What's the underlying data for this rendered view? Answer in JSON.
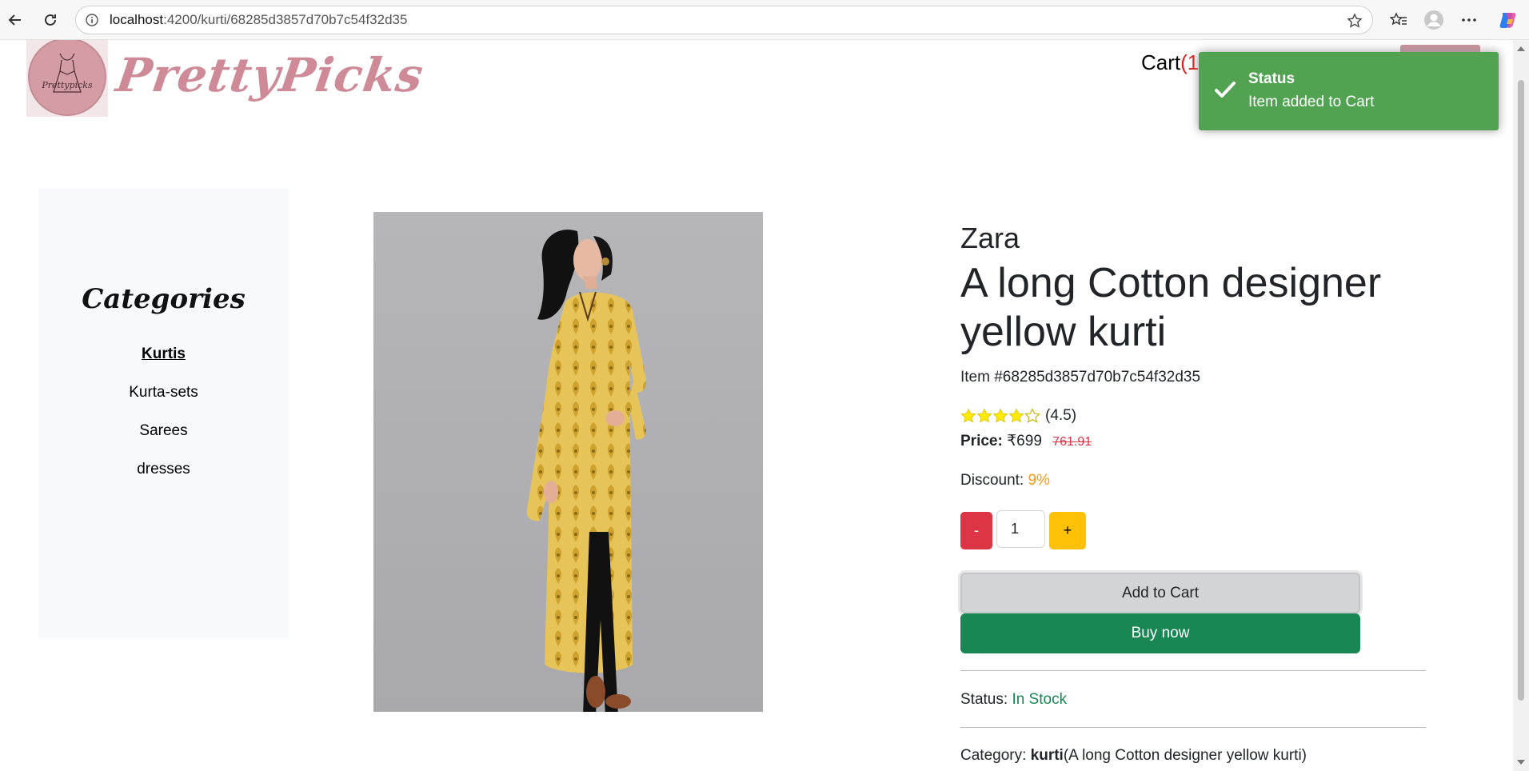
{
  "browser": {
    "url_host": "localhost",
    "url_path": ":4200/kurti/68285d3857d70b7c54f32d35"
  },
  "header": {
    "logo_text": "PrettyPicks",
    "logo_mini_text": "Prettypicks",
    "cart_label": "Cart",
    "cart_count": "(1)"
  },
  "toast": {
    "title": "Status",
    "message": "Item added to Cart",
    "color": "#51a351"
  },
  "sidebar": {
    "heading": "Categories",
    "items": [
      {
        "label": "Kurtis",
        "active": true
      },
      {
        "label": "Kurta-sets",
        "active": false
      },
      {
        "label": "Sarees",
        "active": false
      },
      {
        "label": "dresses",
        "active": false
      }
    ]
  },
  "product": {
    "brand": "Zara",
    "title": "A long Cotton designer yellow kurti",
    "item_id": "Item #68285d3857d70b7c54f32d35",
    "rating": 4.5,
    "rating_text": "(4.5)",
    "price_label": "Price:",
    "price": "₹699",
    "old_price": "761.91",
    "discount_label": "Discount:",
    "discount_value": "9%",
    "quantity": "1",
    "minus_label": "-",
    "plus_label": "+",
    "add_to_cart_label": "Add to Cart",
    "buy_now_label": "Buy now",
    "status_label": "Status:",
    "status_value": "In Stock",
    "category_label": "Category:",
    "category_value": "kurti",
    "category_desc": "(A long Cotton designer yellow kurti)"
  },
  "colors": {
    "accent_pink": "#cf8a98",
    "danger": "#dc3545",
    "warning": "#ffc107",
    "success": "#198754",
    "star": "#ffea00"
  }
}
